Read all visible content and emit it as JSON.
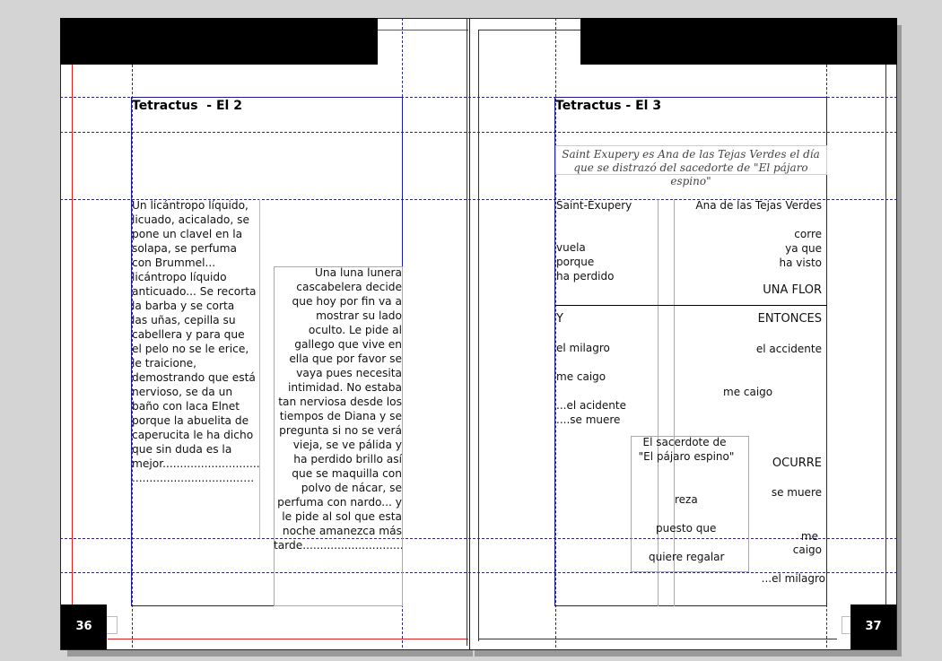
{
  "left_page": {
    "heading": "Tetractus  - El 2",
    "page_number": "36",
    "column_text": [
      "Un licántropo líquido,",
      "licuado, acicalado, se",
      "pone un clavel en la",
      "solapa, se perfuma",
      "con Brummel...",
      "licántropo líquido",
      "anticuado... Se recorta",
      "la barba y se corta",
      "las uñas, cepilla su",
      "cabellera y para que",
      "el pelo no se le erice,",
      "le traicione,",
      "demostrando que está",
      "nervioso, se da un",
      "baño con laca Elnet",
      "porque la abuelita de",
      "caperucita le ha dicho",
      "que sin duda es la",
      "mejor...............................................",
      "...............................…."
    ],
    "box_text": [
      "Una luna lunera",
      "cascabelera decide",
      "que hoy por fin va a",
      "mostrar su lado",
      "oculto. Le pide al",
      "gallego que vive en",
      "ella que por favor se",
      "vaya pues necesita",
      "intimidad. No estaba",
      "tan nerviosa desde los",
      "tiempos de Diana y se",
      "pregunta si no se verá",
      "vieja, se ve pálida y",
      "ha perdido brillo así",
      "que se maquilla con",
      "polvo de nácar, se",
      "perfuma con nardo... y",
      "le pide al sol que esta",
      "noche amanezca más",
      "tarde..............................................."
    ]
  },
  "right_page": {
    "heading": "Tetractus - El 3",
    "page_number": "37",
    "subtitle_line1": "Saint Exupery es Ana de las Tejas Verdes el día",
    "subtitle_line2": "que se distrazó del sacedorte de \"El pájaro espino\"",
    "saint_exupery": "Saint-Exupery",
    "ana_tejas": "Ana de las Tejas Verdes",
    "corre": "corre",
    "ya_que": "ya que",
    "ha_visto": "ha visto",
    "vuela": "vuela",
    "porque": "porque",
    "ha_perdido": "ha perdido",
    "una_flor": "UNA FLOR",
    "y": "Y",
    "entonces": "ENTONCES",
    "el_milagro": "el milagro",
    "el_accidente": "el accidente",
    "me_caigo_left": "me caigo",
    "me_caigo_mid": "me caigo",
    "el_acidente": "...el acidente",
    "se_muere_left": "....se muere",
    "sacerdote_1": "El sacerdote de",
    "sacerdote_2": "\"El pájaro espino\"",
    "ocurre": "OCURRE",
    "se_muere_right": "se muere",
    "reza": "reza",
    "puesto_que": "puesto que",
    "me": "me",
    "caigo": "caigo",
    "quiere_regalar": "quiere regalar",
    "el_milagro_end": "...el milagro"
  }
}
